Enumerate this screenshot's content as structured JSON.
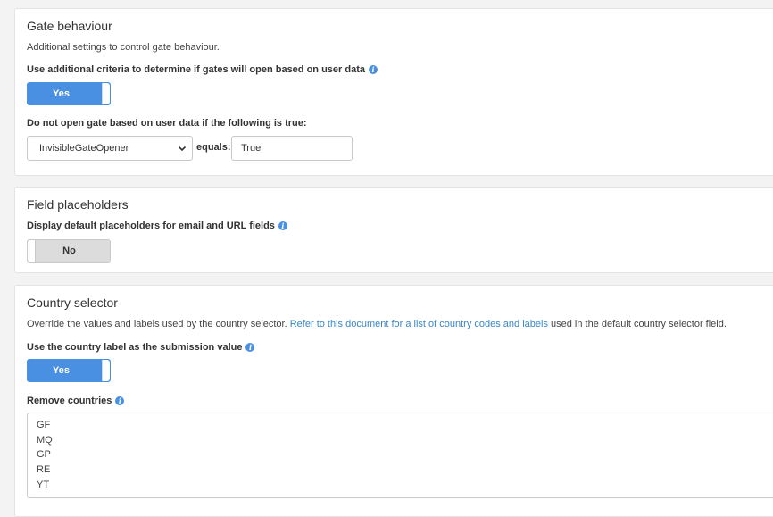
{
  "gate": {
    "title": "Gate behaviour",
    "description": "Additional settings to control gate behaviour.",
    "criteria_label": "Use additional criteria to determine if gates will open based on user data",
    "criteria_toggle": "Yes",
    "condition_label": "Do not open gate based on user data if the following is true:",
    "field_select_value": "InvisibleGateOpener",
    "equals_label": "equals:",
    "equals_value": "True"
  },
  "placeholders": {
    "title": "Field placeholders",
    "display_label": "Display default placeholders for email and URL fields",
    "display_toggle": "No"
  },
  "country": {
    "title": "Country selector",
    "description_before": "Override the values and labels used by the country selector.",
    "description_link": "Refer to this document for a list of country codes and labels",
    "description_after": "used in the default country selector field.",
    "label_as_value_label": "Use the country label as the submission value",
    "label_as_value_toggle": "Yes",
    "remove_label": "Remove countries",
    "removed_countries": [
      "GF",
      "MQ",
      "GP",
      "RE",
      "YT"
    ]
  },
  "colors": {
    "accent": "#4a90e2",
    "link": "#3a86c8",
    "toggle_off": "#dcdcdc"
  }
}
